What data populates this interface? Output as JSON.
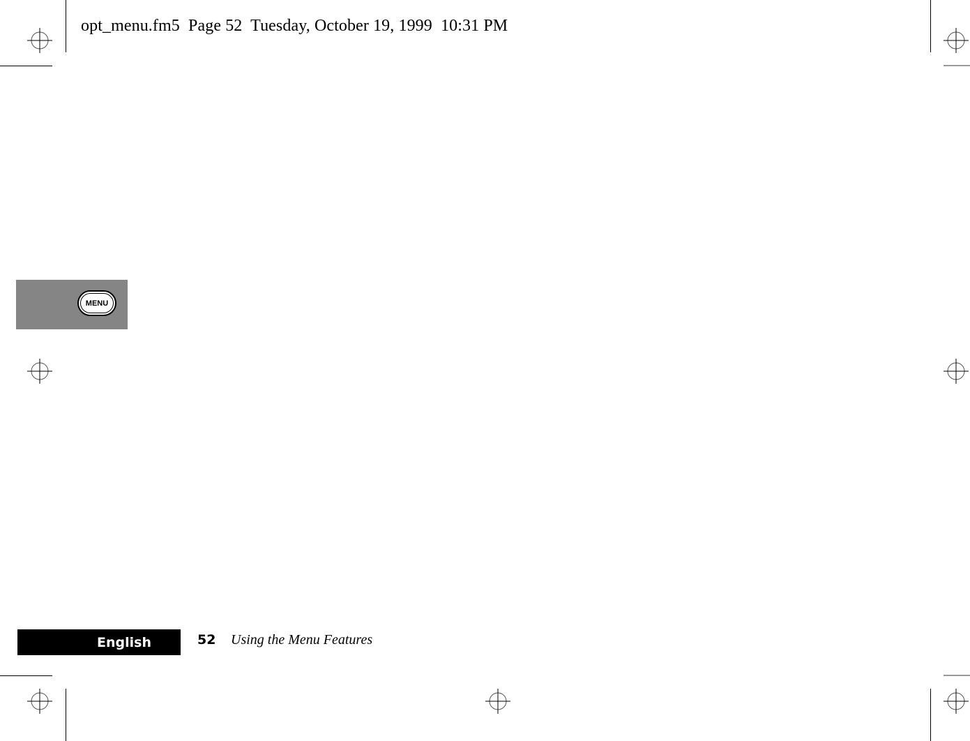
{
  "header": {
    "print_info": "opt_menu.fm5  Page 52  Tuesday, October 19, 1999  10:31 PM"
  },
  "side_tab": {
    "button_label": "MENU",
    "icon": "menu-key-icon",
    "background_color": "#858585"
  },
  "footer": {
    "language": "English",
    "page_number": "52",
    "section_title": "Using the Menu Features"
  },
  "registration_marks": {
    "icon": "crosshair-registration-icon",
    "count": 7
  }
}
